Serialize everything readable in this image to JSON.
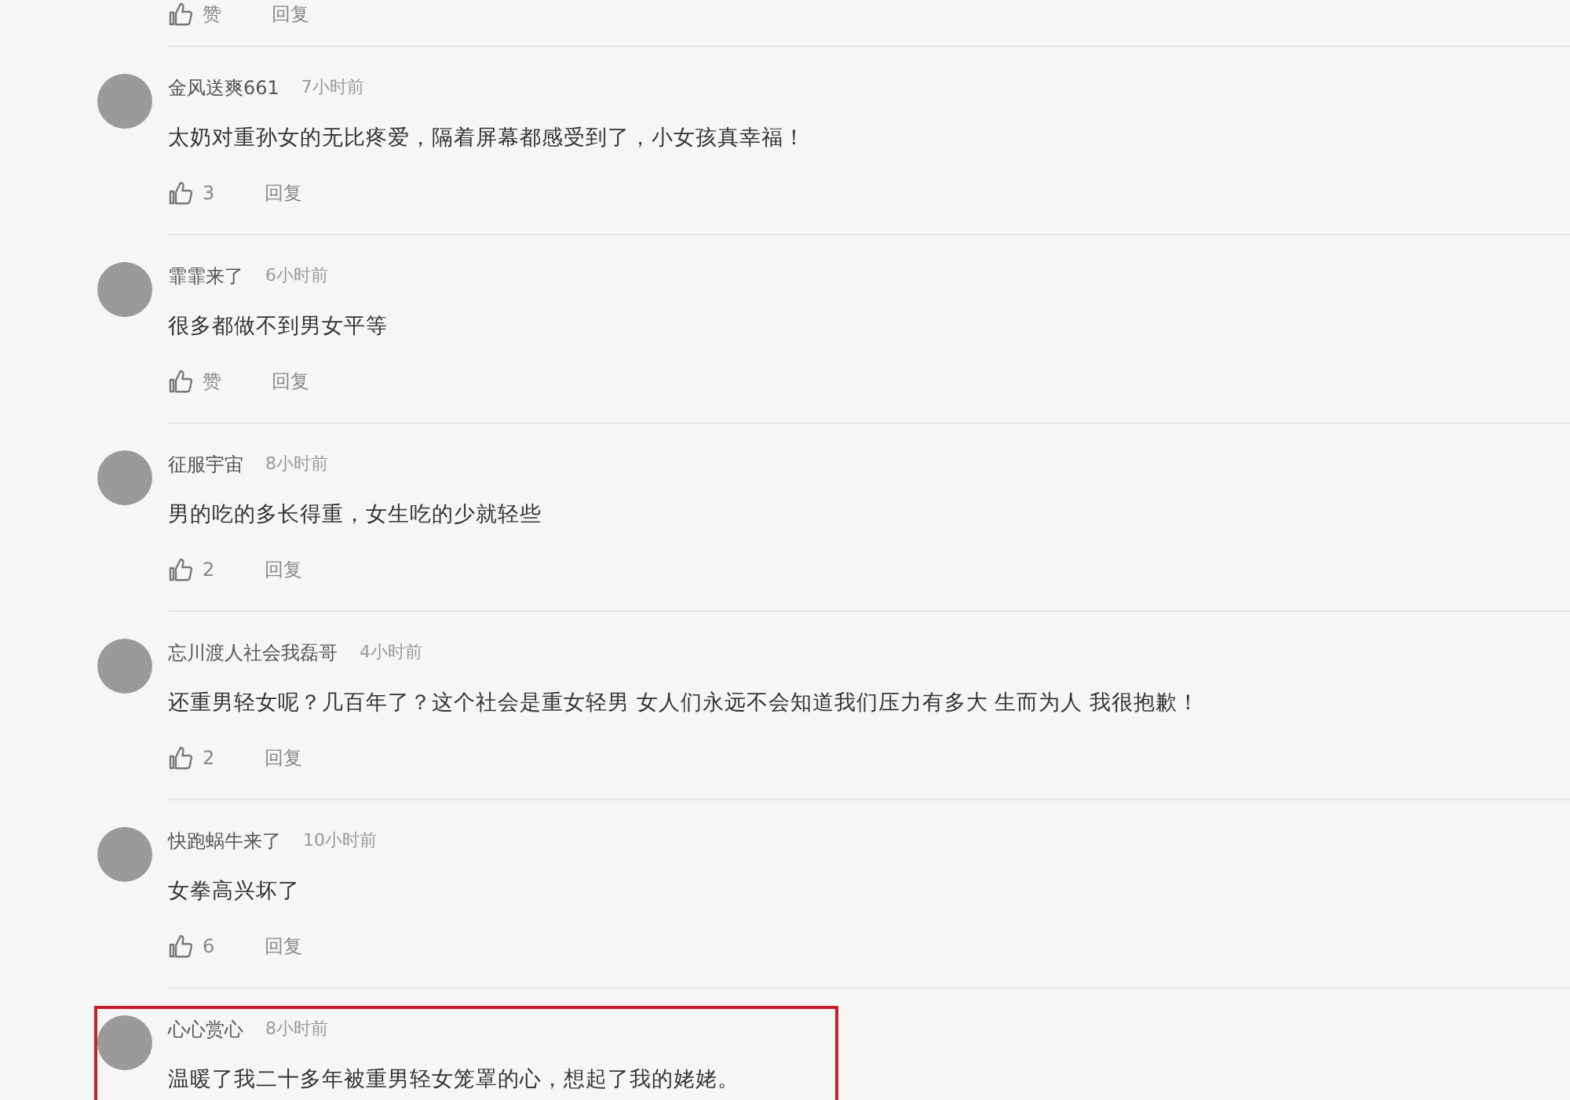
{
  "top_actions": {
    "like": "赞",
    "reply": "回复"
  },
  "comments": [
    {
      "user": "金风送爽661",
      "time": "7小时前",
      "text": "太奶对重孙女的无比疼爱，隔着屏幕都感受到了，小女孩真幸福！",
      "like": "3",
      "reply": "回复",
      "highlighted": false
    },
    {
      "user": "霏霏来了",
      "time": "6小时前",
      "text": "很多都做不到男女平等",
      "like": "赞",
      "reply": "回复",
      "highlighted": false
    },
    {
      "user": "征服宇宙",
      "time": "8小时前",
      "text": "男的吃的多长得重，女生吃的少就轻些",
      "like": "2",
      "reply": "回复",
      "highlighted": false
    },
    {
      "user": "忘川渡人社会我磊哥",
      "time": "4小时前",
      "text": "还重男轻女呢？几百年了？这个社会是重女轻男 女人们永远不会知道我们压力有多大 生而为人 我很抱歉！",
      "like": "2",
      "reply": "回复",
      "highlighted": false
    },
    {
      "user": "快跑蜗牛来了",
      "time": "10小时前",
      "text": "女拳高兴坏了",
      "like": "6",
      "reply": "回复",
      "highlighted": false
    },
    {
      "user": "心心赏心",
      "time": "8小时前",
      "text": "温暖了我二十多年被重男轻女笼罩的心，想起了我的姥姥。",
      "highlighted": true
    }
  ]
}
